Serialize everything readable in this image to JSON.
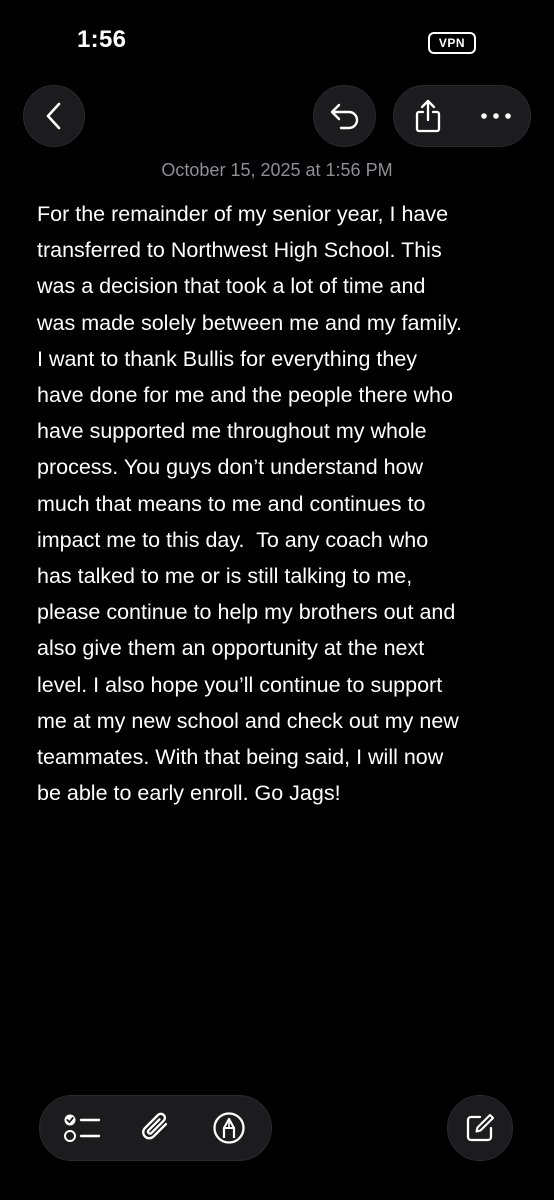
{
  "status_bar": {
    "time": "1:56",
    "vpn_label": "VPN"
  },
  "nav": {
    "back_icon": "chevron-left-icon",
    "undo_icon": "undo-icon",
    "share_icon": "share-icon",
    "more_icon": "ellipsis-icon"
  },
  "note": {
    "date": "October 15, 2025 at 1:56 PM",
    "lines": [
      "For the remainder of my senior year, I have",
      "transferred to Northwest High School. This",
      "was a decision that took a lot of time and",
      "was made solely between me and my family.",
      "I want to thank Bullis for everything they",
      "have done for me and the people there who",
      "have supported me throughout my whole",
      "process. You guys don’t understand how",
      "much that means to me and continues to",
      "impact me to this day.  To any coach who",
      "has talked to me or is still talking to me,",
      "please continue to help my brothers out and",
      "also give them an opportunity at the next",
      "level. I also hope you’ll continue to support",
      "me at my new school and check out my new",
      "teammates. With that being said, I will now",
      "be able to early enroll. Go Jags!"
    ]
  },
  "toolbar": {
    "checklist_icon": "checklist-icon",
    "attachment_icon": "paperclip-icon",
    "markup_icon": "markup-pen-icon",
    "compose_icon": "compose-icon"
  }
}
